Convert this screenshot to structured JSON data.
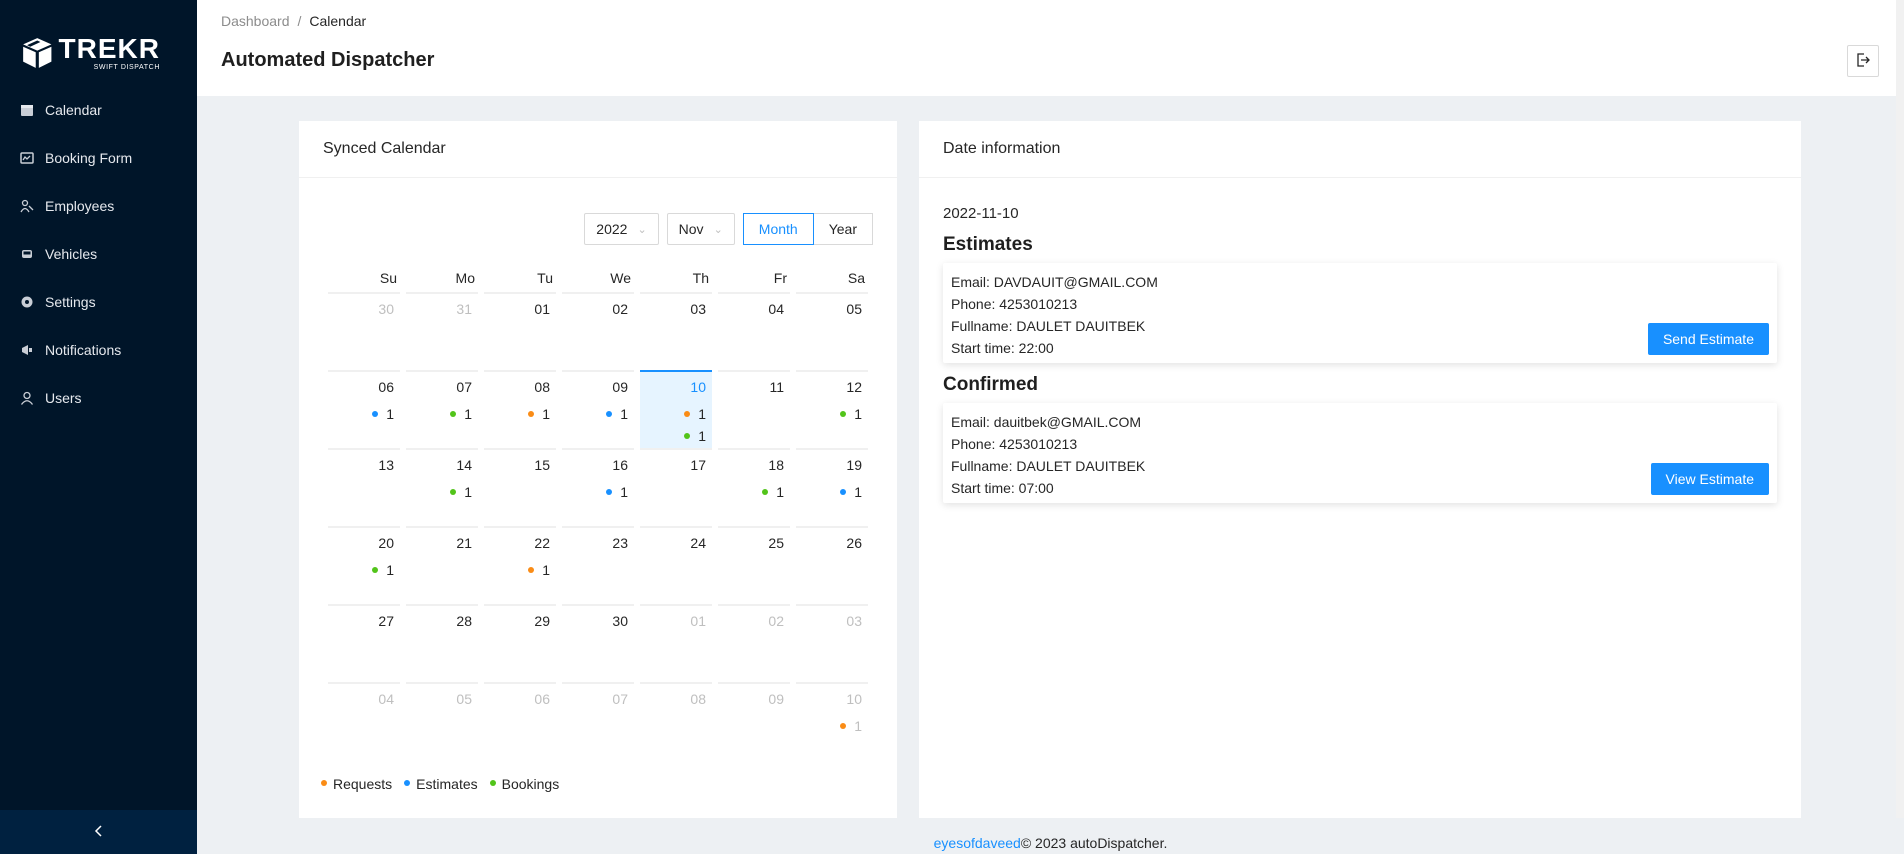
{
  "brand": {
    "name": "TREKR",
    "tagline": "SWIFT DISPATCH"
  },
  "sidebar": {
    "items": [
      {
        "label": "Calendar",
        "icon": "calendar-icon"
      },
      {
        "label": "Booking Form",
        "icon": "form-icon"
      },
      {
        "label": "Employees",
        "icon": "team-icon"
      },
      {
        "label": "Vehicles",
        "icon": "car-icon"
      },
      {
        "label": "Settings",
        "icon": "gear-icon"
      },
      {
        "label": "Notifications",
        "icon": "megaphone-icon"
      },
      {
        "label": "Users",
        "icon": "user-icon"
      }
    ],
    "collapse_icon": "chevron-left-icon"
  },
  "header": {
    "breadcrumb": [
      "Dashboard",
      "Calendar"
    ],
    "title": "Automated Dispatcher",
    "logout_icon": "logout-icon"
  },
  "calendar": {
    "title": "Synced Calendar",
    "year": "2022",
    "month": "Nov",
    "modes": [
      "Month",
      "Year"
    ],
    "active_mode": "Month",
    "weekdays": [
      "Su",
      "Mo",
      "Tu",
      "We",
      "Th",
      "Fr",
      "Sa"
    ],
    "weeks": [
      [
        {
          "d": "30",
          "out": true
        },
        {
          "d": "31",
          "out": true
        },
        {
          "d": "01"
        },
        {
          "d": "02"
        },
        {
          "d": "03"
        },
        {
          "d": "04"
        },
        {
          "d": "05"
        }
      ],
      [
        {
          "d": "06",
          "b": [
            [
              "estimate",
              "1"
            ]
          ]
        },
        {
          "d": "07",
          "b": [
            [
              "booking",
              "1"
            ]
          ]
        },
        {
          "d": "08",
          "b": [
            [
              "request",
              "1"
            ]
          ]
        },
        {
          "d": "09",
          "b": [
            [
              "estimate",
              "1"
            ]
          ]
        },
        {
          "d": "10",
          "today": true,
          "b": [
            [
              "request",
              "1"
            ],
            [
              "booking",
              "1"
            ]
          ]
        },
        {
          "d": "11"
        },
        {
          "d": "12",
          "b": [
            [
              "booking",
              "1"
            ]
          ]
        }
      ],
      [
        {
          "d": "13"
        },
        {
          "d": "14",
          "b": [
            [
              "booking",
              "1"
            ]
          ]
        },
        {
          "d": "15"
        },
        {
          "d": "16",
          "b": [
            [
              "estimate",
              "1"
            ]
          ]
        },
        {
          "d": "17"
        },
        {
          "d": "18",
          "b": [
            [
              "booking",
              "1"
            ]
          ]
        },
        {
          "d": "19",
          "b": [
            [
              "estimate",
              "1"
            ]
          ]
        }
      ],
      [
        {
          "d": "20",
          "b": [
            [
              "booking",
              "1"
            ]
          ]
        },
        {
          "d": "21"
        },
        {
          "d": "22",
          "b": [
            [
              "request",
              "1"
            ]
          ]
        },
        {
          "d": "23"
        },
        {
          "d": "24"
        },
        {
          "d": "25"
        },
        {
          "d": "26"
        }
      ],
      [
        {
          "d": "27"
        },
        {
          "d": "28"
        },
        {
          "d": "29"
        },
        {
          "d": "30"
        },
        {
          "d": "01",
          "out": true
        },
        {
          "d": "02",
          "out": true
        },
        {
          "d": "03",
          "out": true
        }
      ],
      [
        {
          "d": "04",
          "out": true
        },
        {
          "d": "05",
          "out": true
        },
        {
          "d": "06",
          "out": true
        },
        {
          "d": "07",
          "out": true
        },
        {
          "d": "08",
          "out": true
        },
        {
          "d": "09",
          "out": true
        },
        {
          "d": "10",
          "out": true,
          "b": [
            [
              "request",
              "1"
            ]
          ]
        }
      ]
    ],
    "legend": [
      {
        "label": "Requests",
        "type": "request"
      },
      {
        "label": "Estimates",
        "type": "estimate"
      },
      {
        "label": "Bookings",
        "type": "booking"
      }
    ],
    "colors": {
      "request": "#fa8c16",
      "estimate": "#1890ff",
      "booking": "#52c41a"
    }
  },
  "info": {
    "title": "Date information",
    "date": "2022-11-10",
    "estimates": {
      "heading": "Estimates",
      "email": "Email: DAVDAUIT@GMAIL.COM",
      "phone": "Phone: 4253010213",
      "fullname": "Fullname: DAULET DAUITBEK",
      "start": "Start time: 22:00",
      "button": "Send Estimate"
    },
    "confirmed": {
      "heading": "Confirmed",
      "email": "Email: dauitbek@GMAIL.COM",
      "phone": "Phone: 4253010213",
      "fullname": "Fullname: DAULET DAUITBEK",
      "start": "Start time: 07:00",
      "button": "View Estimate"
    }
  },
  "footer": {
    "link": "eyesofdaveed",
    "text": "© 2023 autoDispatcher."
  }
}
